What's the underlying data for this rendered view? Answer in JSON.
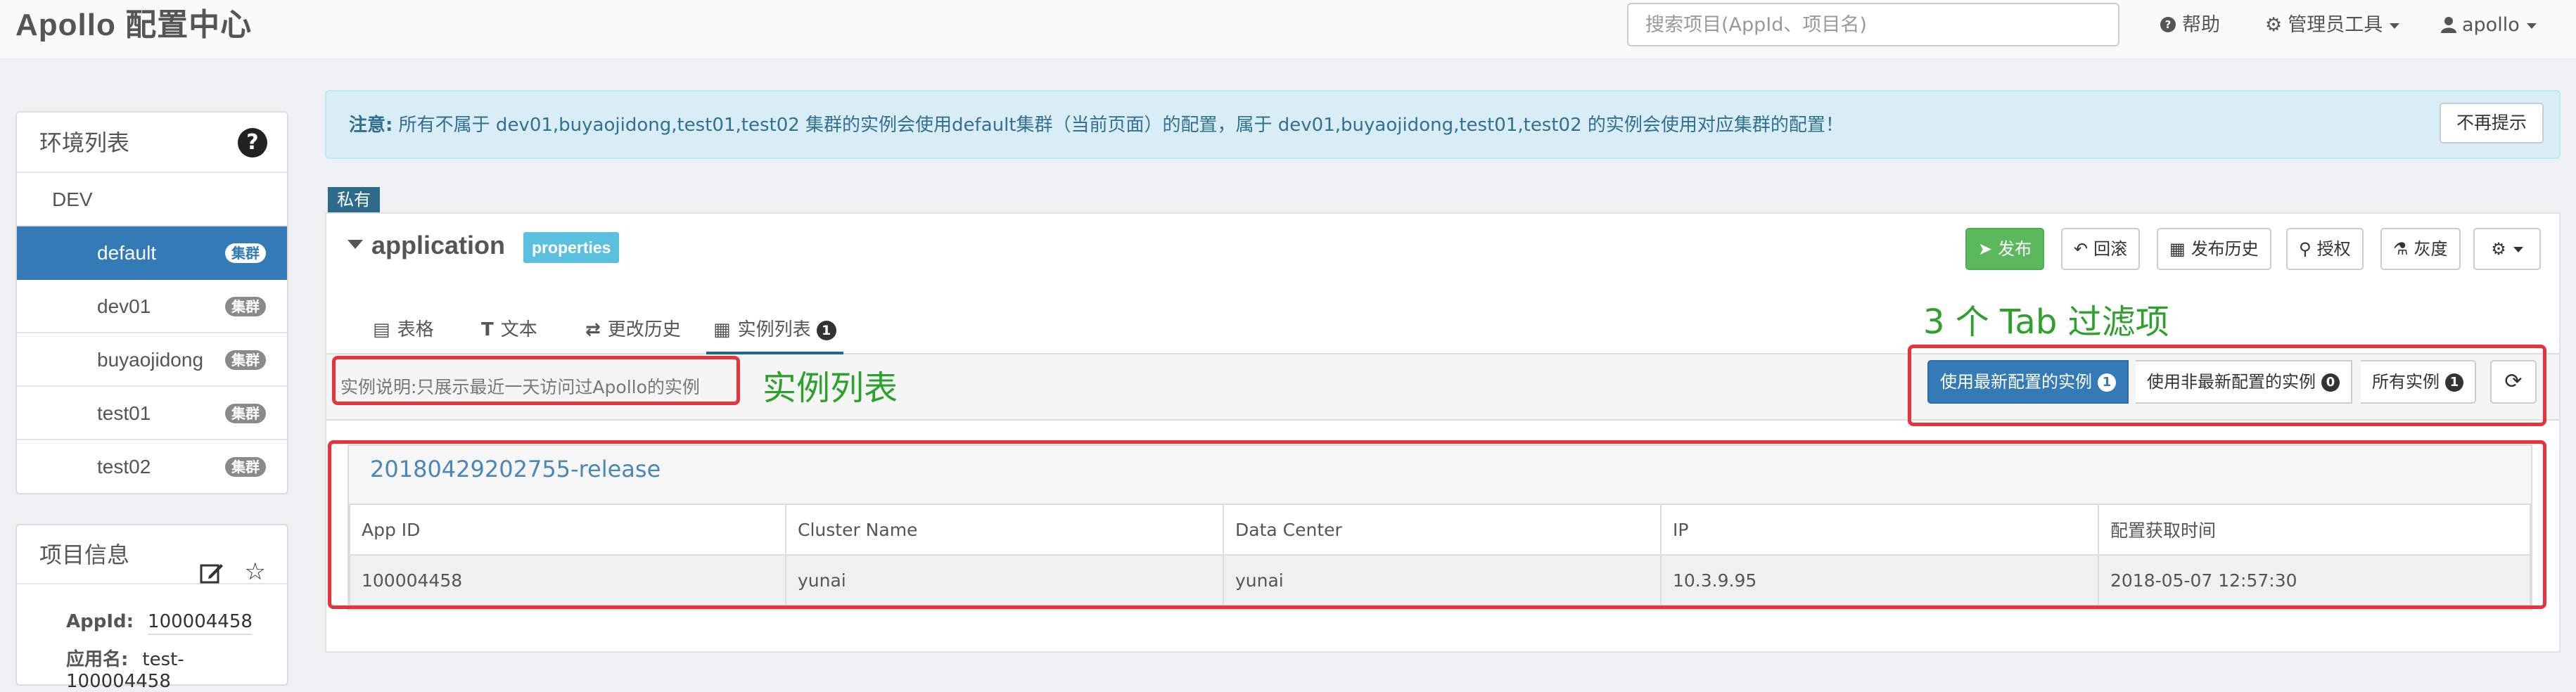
{
  "navbar": {
    "brand": "Apollo 配置中心",
    "search_placeholder": "搜索项目(AppId、项目名)",
    "help": "帮助",
    "admin_tools": "管理员工具",
    "user": "apollo"
  },
  "sidebar": {
    "env_title": "环境列表",
    "env_name": "DEV",
    "cluster_badge": "集群",
    "clusters": [
      {
        "name": "default"
      },
      {
        "name": "dev01"
      },
      {
        "name": "buyaojidong"
      },
      {
        "name": "test01"
      },
      {
        "name": "test02"
      }
    ],
    "project_title": "项目信息",
    "appid_label": "AppId:",
    "appid_value": "100004458",
    "appname_label": "应用名:",
    "appname_value": "test-100004458"
  },
  "notice": {
    "prefix": "注意:",
    "text": "所有不属于 dev01,buyaojidong,test01,test02 集群的实例会使用default集群（当前页面）的配置，属于 dev01,buyaojidong,test01,test02 的实例会使用对应集群的配置！",
    "dismiss": "不再提示"
  },
  "namespace": {
    "private_label": "私有",
    "name": "application",
    "format": "properties",
    "buttons": {
      "publish": "发布",
      "rollback": "回滚",
      "history": "发布历史",
      "grant": "授权",
      "gray": "灰度"
    },
    "tabs": [
      {
        "label": "表格"
      },
      {
        "label": "文本"
      },
      {
        "label": "更改历史"
      },
      {
        "label": "实例列表",
        "badge": "1"
      }
    ],
    "instance_desc": "实例说明:只展示最近一天访问过Apollo的实例",
    "filters": [
      {
        "label": "使用最新配置的实例",
        "count": "1"
      },
      {
        "label": "使用非最新配置的实例",
        "count": "0"
      },
      {
        "label": "所有实例",
        "count": "1"
      }
    ],
    "release": {
      "title": "20180429202755-release",
      "columns": [
        "App ID",
        "Cluster Name",
        "Data Center",
        "IP",
        "配置获取时间"
      ],
      "row": [
        "100004458",
        "yunai",
        "yunai",
        "10.3.9.95",
        "2018-05-07 12:57:30"
      ]
    }
  },
  "annotations": {
    "tabs_note": "3 个 Tab 过滤项",
    "list_note": "实例列表"
  },
  "colors": {
    "primary": "#337ab7",
    "success": "#5cb85c",
    "info": "#5bc0de",
    "annotation_red": "#e8323c",
    "annotation_green": "#2ca12c"
  }
}
